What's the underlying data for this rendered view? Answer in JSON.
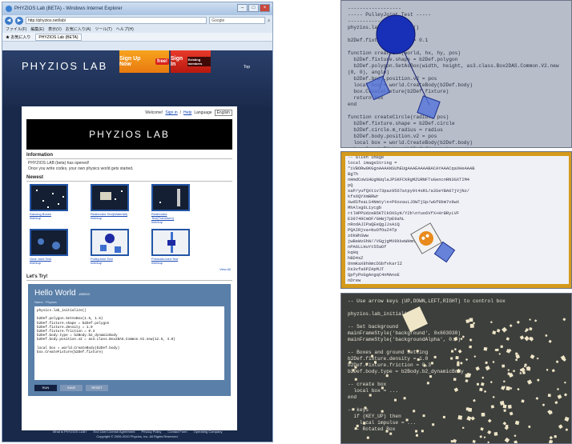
{
  "browser": {
    "title": "PHYZIOS Lab (BETA) - Windows Internet Explorer",
    "url": "http://phyzios.net/lab/",
    "search_placeholder": "Google",
    "menu": [
      "ファイル(F)",
      "編集(E)",
      "表示(V)",
      "お気に入り(A)",
      "ツール(T)",
      "ヘルプ(H)"
    ],
    "favorites_label": "お気に入り",
    "tab_title": "PHYZIOS Lab (BETA)",
    "window_buttons": [
      "–",
      "□",
      "×"
    ]
  },
  "site": {
    "logo": "PHYZIOS LAB",
    "signup": {
      "label": "Sign Up Now",
      "badge": "free!"
    },
    "signin": {
      "label": "Sign In",
      "badge": "Existing members"
    },
    "top_link": "Top",
    "welcome": {
      "text": "Welcome!",
      "signin": "Sign in",
      "sep": "/",
      "help": "Help",
      "language_label": "Language",
      "language_value": "English"
    },
    "hero": "PHYZIOS LAB",
    "information": {
      "title": "Information",
      "lines": [
        "PHYZIOS LAB (beta) has opened!",
        "Once you write codes, your own physics world gets started."
      ]
    },
    "newest": {
      "title": "Newest",
      "items": [
        {
          "title": "Dancing Boxes",
          "author": "hidekup"
        },
        {
          "title": "Redirected Text(Waterfall)",
          "author": "hidekup"
        },
        {
          "title": "Redirected Text(Transform)",
          "author": "hidekup"
        },
        {
          "title": "Gear Joint Test",
          "author": "hidekup"
        },
        {
          "title": "PulleyJoint Test",
          "author": "hidekup"
        },
        {
          "title": "PrismaticJoint Test",
          "author": "hidekup"
        }
      ],
      "view_all": "View All"
    },
    "try": {
      "title": "Let's Try!",
      "hello": "Hello World",
      "hello_id": "#00010",
      "name_label": "Name",
      "name_value": "Physics",
      "code": "physics.lab_initialize()\n\nb2Def.polygon.SetAsBox(1.5, 1.5)\nb2Def.fixture.shape = b2Def.polygon\nb2Def.fixture.density = 1.0\nb2Def.fixture.friction = 0.3\nb2Def.body.type = b2Body.b2_dynamicBody\nb2Def.body.position.v2 = as3.class.Box2DAS.Common.V2.new(12.5, 4.0)\n\nlocal box = world.CreateBody(b2Def.body)\nbox.CreateFixture(b2Def.fixture)",
      "buttons": [
        "RUN",
        "SAVE",
        "RESET"
      ]
    },
    "footer": {
      "links": [
        "What is PHYZIOS LAB?",
        "End User License Agreement",
        "Privacy Policy",
        "Contact Form",
        "Operating Company"
      ],
      "copyright": "Copyright © 2009-2010 Phyzios, Inc. All Rights Reserved."
    }
  },
  "panels": {
    "pulley": {
      "code": "------------------\n----- PulleyJoint Test -----\n------------------\nphyzios.lab_initialize()\n\nb2Def.fixture.density = 0.1\n\nfunction createBox(world, hx, hy, pos)\n  b2Def.fixture.shape = b2Def.polygon\n  b2Def.polygon.SetAsBox(width, height, as3.class.Box2DAS.Common.V2.new\n(0, 0), angle)\n  b2Def.body.position.v2 = pos\n  local box = world.CreateBody(b2Def.body)\n  box.CreateFixture(b2Def.fixture)\n  return box\nend\n\nfunction createCircle(radius, pos)\n  b2Def.fixture.shape = b2Def.circle\n  b2Def.circle.m_radius = radius\n  b2Def.body.position.v2 = pos\n  local box = world.CreateBody(b2Def.body)\n  box.CreateFixture(b2Def.fixture)"
    },
    "alien": {
      "code": "-- alien image\nlocal imageString =\n\"iVBORw0KGgoAAAANSUhEUgAAAEAAAABACAYAAACqaXHeAAAB\nBgTh\nnHmdCoW1HUgNUqlaJPSKFCkRgMZURNFTuGencnRN3GXTIM4\npQ\nsaP/yufQXtiv73paz9567atpy9t4sR1/a3SeYBA07jVjNz/\nkfs6QYXmBRWr\nXwdSfeaLS4Nmty\\n+P6ozauLJOWTjSp/wGf8bm7v9wX\nMhAlsg6L1ycgb\nrtlHPPUdzeB5KTCkOXSyK/Y2b\\nYuo6VfX+HrBRyLVF\nE39749CmOF/GHWj7pE9ahL\nnRodAJIPaQEeQgJJsAiQ\nPQAIRjva+NuOfOuZ4Tp\nz6kWhSWw\njwBeWvShN//VGgjgMV9kkeWHmnGepZ\nnPA6LLHuYt55aOf\nkqHq\nhBD4sZ\nOnmKaX8h0mcDSbfvkarIZ\nDs3vfa6PZApMJT\nQpfyPoGgAngqC4nMAnoE\nnDrew",
      "hud": "FPS 30"
    },
    "keys": {
      "code": "-- Use arrow keys (UP,DOWN,LEFT,RIGHT) to control box\n\nphyzios.lab_initialize()\n\n-- Set background\nmainFrameStyle('background', 0x603030)\nmainFrameStyle('backgroundAlpha', 0.7)\n\n-- Boxes and ground setting\nb2Def.fixture.density = 1.0\nb2Def.fixture.friction = 0.3\nb2Def.body.type = b2Body.b2_dynamicBody\n\n-- create box\n  local box = ...\nend\n\n-- keys\n  if (KEY_UP) then\n    local impulse = ...\n  -- Rotated Box"
    }
  },
  "colors": {
    "site_bg": "#19294a",
    "accent_orange": "#f08a15",
    "accent_red": "#d32519",
    "link": "#1a4bb8"
  }
}
